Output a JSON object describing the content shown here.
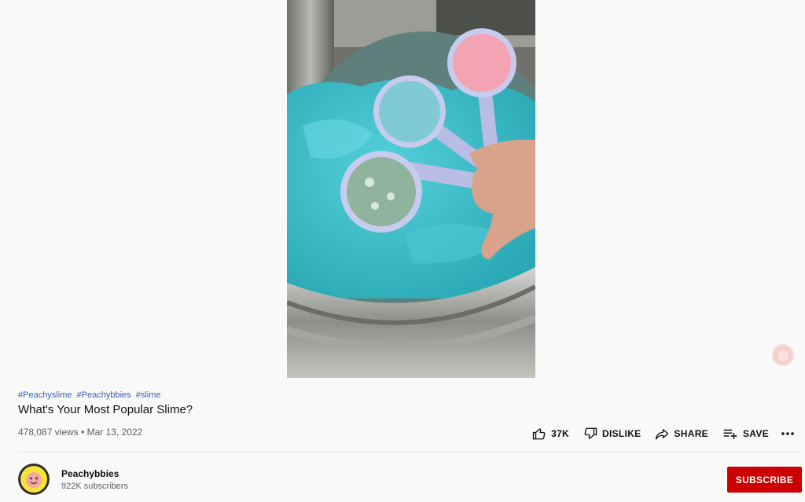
{
  "video": {
    "hashtags": [
      "#Peachyslime",
      "#Peachybbies",
      "#slime"
    ],
    "title": "What's Your Most Popular Slime?",
    "views": "478,087 views",
    "separator": "•",
    "date": "Mar 13, 2022"
  },
  "actions": {
    "like_count": "37K",
    "dislike_label": "DISLIKE",
    "share_label": "SHARE",
    "save_label": "SAVE",
    "more_icon": "more-horizontal-icon"
  },
  "channel": {
    "name": "Peachybbies",
    "subscribers": "922K subscribers",
    "subscribe_label": "SUBSCRIBE"
  },
  "colors": {
    "subscribe_bg": "#cc0000",
    "hashtag": "#3364b8",
    "slime": "#2fb7c4"
  }
}
